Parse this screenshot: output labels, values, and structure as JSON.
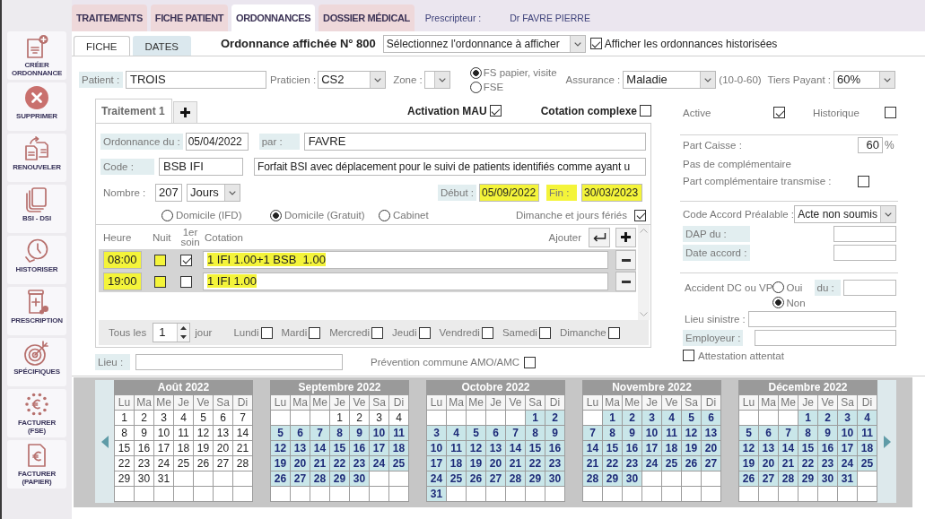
{
  "top_tabs": [
    {
      "label": "TRAITEMENTS",
      "selected": false
    },
    {
      "label": "FICHE PATIENT",
      "selected": false
    },
    {
      "label": "ORDONNANCES",
      "selected": true
    },
    {
      "label": "DOSSIER MÉDICAL",
      "selected": false
    }
  ],
  "prescriber": {
    "label": "Prescripteur :",
    "value": "Dr FAVRE PIERRE"
  },
  "sidebar": {
    "items": [
      {
        "label": "CRÉER ORDONNANCE",
        "kind": "create"
      },
      {
        "label": "SUPPRIMER",
        "kind": "delete"
      },
      {
        "label": "RENOUVELER",
        "kind": "renew"
      },
      {
        "label": "BSI - DSI",
        "kind": "pages"
      },
      {
        "label": "HISTORISER",
        "kind": "history"
      },
      {
        "label": "PRESCRIPTION",
        "kind": "prescription"
      },
      {
        "label": "SPÉCIFIQUES",
        "kind": "target"
      },
      {
        "label": "FACTURER (FSE)",
        "kind": "bill_fse"
      },
      {
        "label": "FACTURER (PAPIER)",
        "kind": "bill_paper"
      }
    ]
  },
  "sub_tabs": [
    {
      "label": "FICHE",
      "selected": true
    },
    {
      "label": "DATES",
      "selected": false
    }
  ],
  "ordonnance": {
    "title": "Ordonnance affichée N° 800",
    "select_value": "Sélectionnez l'ordonnance à afficher",
    "show_historised": {
      "label": "Afficher les ordonnances historisées",
      "checked": true
    }
  },
  "patient_row": {
    "patient": {
      "label": "Patient :",
      "value": "TROIS"
    },
    "praticien": {
      "label": "Praticien :",
      "value": "CS2"
    },
    "zone": {
      "label": "Zone :"
    },
    "billing_mode": [
      {
        "label": "FS papier, visite",
        "selected": true
      },
      {
        "label": "FSE",
        "selected": false
      }
    ],
    "assurance": {
      "label": "Assurance :",
      "value": "Maladie",
      "rates": "(10-0-60)"
    },
    "tiers_payant": {
      "label": "Tiers Payant :",
      "value": "60%"
    }
  },
  "treatment": {
    "tabs": [
      {
        "label": "Traitement 1",
        "selected": true
      }
    ],
    "mau": {
      "label": "Activation MAU",
      "checked": true
    },
    "cotation_complexe": {
      "label": "Cotation complexe",
      "checked": false
    },
    "ordonnance_date": {
      "label": "Ordonnance du :",
      "value": "05/04/2022"
    },
    "par": {
      "label": "par :",
      "value": "FAVRE"
    },
    "code": {
      "label": "Code :",
      "value": "BSB IFI",
      "description": "Forfait BSI avec déplacement pour le suivi de patients identifiés comme ayant u"
    },
    "nombre": {
      "label": "Nombre :",
      "value": "207",
      "unit": "Jours"
    },
    "debut": {
      "label": "Début :",
      "value": "05/09/2022",
      "highlighted": true
    },
    "fin": {
      "label": "Fin :",
      "value": "30/03/2023",
      "highlighted": true
    },
    "place": [
      {
        "label": "Domicile (IFD)",
        "selected": false
      },
      {
        "label": "Domicile (Gratuit)",
        "selected": true
      },
      {
        "label": "Cabinet",
        "selected": false
      }
    ],
    "sundays": {
      "label": "Dimanche et jours fériés",
      "checked": true
    },
    "schedule": {
      "columns": [
        "Heure",
        "Nuit",
        "1er soin",
        "Cotation"
      ],
      "add_label": "Ajouter",
      "rows": [
        {
          "time": "08:00",
          "night": false,
          "first_care": true,
          "cotation": "1 IFI 1.00+1 BSB  1.00",
          "highlighted": true
        },
        {
          "time": "19:00",
          "night": false,
          "first_care": false,
          "cotation": "1 IFI 1.00",
          "highlighted": true
        }
      ]
    },
    "recurrence": {
      "label": "Tous les",
      "value": "1",
      "unit": "jour",
      "days": [
        {
          "label": "Lundi",
          "checked": false
        },
        {
          "label": "Mardi",
          "checked": false
        },
        {
          "label": "Mercredi",
          "checked": false
        },
        {
          "label": "Jeudi",
          "checked": false
        },
        {
          "label": "Vendredi",
          "checked": false
        },
        {
          "label": "Samedi",
          "checked": false
        },
        {
          "label": "Dimanche",
          "checked": false
        }
      ]
    }
  },
  "lieu": {
    "label": "Lieu :"
  },
  "prevention": {
    "label": "Prévention commune AMO/AMC",
    "checked": false
  },
  "status": {
    "active": {
      "label": "Active",
      "checked": true
    },
    "historique": {
      "label": "Historique",
      "checked": false
    }
  },
  "coverage": {
    "part_caisse": {
      "label": "Part Caisse :",
      "value": "60",
      "unit": "%"
    },
    "complementaire": "Pas de complémentaire",
    "part_complementaire": {
      "label": "Part complémentaire transmise :",
      "checked": false
    }
  },
  "accord": {
    "code": {
      "label": "Code Accord Préalable :",
      "value": "Acte non soumis"
    },
    "dap": {
      "label": "DAP du :"
    },
    "date_accord": {
      "label": "Date accord :"
    }
  },
  "accident": {
    "label": "Accident DC ou VP",
    "options": [
      {
        "label": "Oui",
        "selected": false
      },
      {
        "label": "Non",
        "selected": true
      }
    ],
    "date": {
      "label": "du :"
    },
    "lieu_sinistre": {
      "label": "Lieu sinistre :"
    },
    "employeur": {
      "label": "Employeur :"
    },
    "attestation": {
      "label": "Attestation attentat",
      "checked": false
    }
  },
  "calendar": {
    "months": [
      {
        "title": "Août 2022",
        "weekdays": [
          "Lu",
          "Ma",
          "Me",
          "Je",
          "Ve",
          "Sa",
          "Di"
        ],
        "weeks": [
          [
            {
              "day": "1",
              "highlighted": false
            },
            {
              "day": "2",
              "highlighted": false
            },
            {
              "day": "3",
              "highlighted": false
            },
            {
              "day": "4",
              "highlighted": false
            },
            {
              "day": "5",
              "highlighted": false
            },
            {
              "day": "6",
              "highlighted": false
            },
            {
              "day": "7",
              "highlighted": false
            }
          ],
          [
            {
              "day": "8",
              "highlighted": false
            },
            {
              "day": "9",
              "highlighted": false
            },
            {
              "day": "10",
              "highlighted": false
            },
            {
              "day": "11",
              "highlighted": false
            },
            {
              "day": "12",
              "highlighted": false
            },
            {
              "day": "13",
              "highlighted": false
            },
            {
              "day": "14",
              "highlighted": false
            }
          ],
          [
            {
              "day": "15",
              "highlighted": false
            },
            {
              "day": "16",
              "highlighted": false
            },
            {
              "day": "17",
              "highlighted": false
            },
            {
              "day": "18",
              "highlighted": false
            },
            {
              "day": "19",
              "highlighted": false
            },
            {
              "day": "20",
              "highlighted": false
            },
            {
              "day": "21",
              "highlighted": false
            }
          ],
          [
            {
              "day": "22",
              "highlighted": false
            },
            {
              "day": "23",
              "highlighted": false
            },
            {
              "day": "24",
              "highlighted": false
            },
            {
              "day": "25",
              "highlighted": false
            },
            {
              "day": "26",
              "highlighted": false
            },
            {
              "day": "27",
              "highlighted": false
            },
            {
              "day": "28",
              "highlighted": false
            }
          ],
          [
            {
              "day": "29",
              "highlighted": false
            },
            {
              "day": "30",
              "highlighted": false
            },
            {
              "day": "31",
              "highlighted": false
            }
          ]
        ]
      },
      {
        "title": "Septembre 2022",
        "weekdays": [
          "Lu",
          "Ma",
          "Me",
          "Je",
          "Ve",
          "Sa",
          "Di"
        ],
        "weeks": [
          [
            {
              "day": "1",
              "highlighted": false
            },
            {
              "day": "2",
              "highlighted": false
            },
            {
              "day": "3",
              "highlighted": false
            },
            {
              "day": "4",
              "highlighted": false
            }
          ],
          [
            {
              "day": "5",
              "highlighted": true
            },
            {
              "day": "6",
              "highlighted": true
            },
            {
              "day": "7",
              "highlighted": true
            },
            {
              "day": "8",
              "highlighted": true
            },
            {
              "day": "9",
              "highlighted": true
            },
            {
              "day": "10",
              "highlighted": true
            },
            {
              "day": "11",
              "highlighted": true
            }
          ],
          [
            {
              "day": "12",
              "highlighted": true
            },
            {
              "day": "13",
              "highlighted": true
            },
            {
              "day": "14",
              "highlighted": true
            },
            {
              "day": "15",
              "highlighted": true
            },
            {
              "day": "16",
              "highlighted": true
            },
            {
              "day": "17",
              "highlighted": true
            },
            {
              "day": "18",
              "highlighted": true
            }
          ],
          [
            {
              "day": "19",
              "highlighted": true
            },
            {
              "day": "20",
              "highlighted": true
            },
            {
              "day": "21",
              "highlighted": true
            },
            {
              "day": "22",
              "highlighted": true
            },
            {
              "day": "23",
              "highlighted": true
            },
            {
              "day": "24",
              "highlighted": true
            },
            {
              "day": "25",
              "highlighted": true
            }
          ],
          [
            {
              "day": "26",
              "highlighted": true
            },
            {
              "day": "27",
              "highlighted": true
            },
            {
              "day": "28",
              "highlighted": true
            },
            {
              "day": "29",
              "highlighted": true
            },
            {
              "day": "30",
              "highlighted": true
            }
          ]
        ]
      },
      {
        "title": "Octobre 2022",
        "weekdays": [
          "Lu",
          "Ma",
          "Me",
          "Je",
          "Ve",
          "Sa",
          "Di"
        ],
        "weeks": [
          [
            {
              "day": "1",
              "highlighted": true
            },
            {
              "day": "2",
              "highlighted": true
            }
          ],
          [
            {
              "day": "3",
              "highlighted": true
            },
            {
              "day": "4",
              "highlighted": true
            },
            {
              "day": "5",
              "highlighted": true
            },
            {
              "day": "6",
              "highlighted": true
            },
            {
              "day": "7",
              "highlighted": true
            },
            {
              "day": "8",
              "highlighted": true
            },
            {
              "day": "9",
              "highlighted": true
            }
          ],
          [
            {
              "day": "10",
              "highlighted": true
            },
            {
              "day": "11",
              "highlighted": true
            },
            {
              "day": "12",
              "highlighted": true
            },
            {
              "day": "13",
              "highlighted": true
            },
            {
              "day": "14",
              "highlighted": true
            },
            {
              "day": "15",
              "highlighted": true
            },
            {
              "day": "16",
              "highlighted": true
            }
          ],
          [
            {
              "day": "17",
              "highlighted": true
            },
            {
              "day": "18",
              "highlighted": true
            },
            {
              "day": "19",
              "highlighted": true
            },
            {
              "day": "20",
              "highlighted": true
            },
            {
              "day": "21",
              "highlighted": true
            },
            {
              "day": "22",
              "highlighted": true
            },
            {
              "day": "23",
              "highlighted": true
            }
          ],
          [
            {
              "day": "24",
              "highlighted": true
            },
            {
              "day": "25",
              "highlighted": true
            },
            {
              "day": "26",
              "highlighted": true
            },
            {
              "day": "27",
              "highlighted": true
            },
            {
              "day": "28",
              "highlighted": true
            },
            {
              "day": "29",
              "highlighted": true
            },
            {
              "day": "30",
              "highlighted": true
            }
          ],
          [
            {
              "day": "31",
              "highlighted": true
            }
          ]
        ]
      },
      {
        "title": "Novembre 2022",
        "weekdays": [
          "Lu",
          "Ma",
          "Me",
          "Je",
          "Ve",
          "Sa",
          "Di"
        ],
        "weeks": [
          [
            {
              "day": "1",
              "highlighted": true
            },
            {
              "day": "2",
              "highlighted": true
            },
            {
              "day": "3",
              "highlighted": true
            },
            {
              "day": "4",
              "highlighted": true
            },
            {
              "day": "5",
              "highlighted": true
            },
            {
              "day": "6",
              "highlighted": true
            }
          ],
          [
            {
              "day": "7",
              "highlighted": true
            },
            {
              "day": "8",
              "highlighted": true
            },
            {
              "day": "9",
              "highlighted": true
            },
            {
              "day": "10",
              "highlighted": true
            },
            {
              "day": "11",
              "highlighted": true
            },
            {
              "day": "12",
              "highlighted": true
            },
            {
              "day": "13",
              "highlighted": true
            }
          ],
          [
            {
              "day": "14",
              "highlighted": true
            },
            {
              "day": "15",
              "highlighted": true
            },
            {
              "day": "16",
              "highlighted": true
            },
            {
              "day": "17",
              "highlighted": true
            },
            {
              "day": "18",
              "highlighted": true
            },
            {
              "day": "19",
              "highlighted": true
            },
            {
              "day": "20",
              "highlighted": true
            }
          ],
          [
            {
              "day": "21",
              "highlighted": true
            },
            {
              "day": "22",
              "highlighted": true
            },
            {
              "day": "23",
              "highlighted": true
            },
            {
              "day": "24",
              "highlighted": true
            },
            {
              "day": "25",
              "highlighted": true
            },
            {
              "day": "26",
              "highlighted": true
            },
            {
              "day": "27",
              "highlighted": true
            }
          ],
          [
            {
              "day": "28",
              "highlighted": true
            },
            {
              "day": "29",
              "highlighted": true
            },
            {
              "day": "30",
              "highlighted": true
            }
          ]
        ]
      },
      {
        "title": "Décembre 2022",
        "weekdays": [
          "Lu",
          "Ma",
          "Me",
          "Je",
          "Ve",
          "Sa",
          "Di"
        ],
        "weeks": [
          [
            {
              "day": "1",
              "highlighted": true
            },
            {
              "day": "2",
              "highlighted": true
            },
            {
              "day": "3",
              "highlighted": true
            },
            {
              "day": "4",
              "highlighted": true
            }
          ],
          [
            {
              "day": "5",
              "highlighted": true
            },
            {
              "day": "6",
              "highlighted": true
            },
            {
              "day": "7",
              "highlighted": true
            },
            {
              "day": "8",
              "highlighted": true
            },
            {
              "day": "9",
              "highlighted": true
            },
            {
              "day": "10",
              "highlighted": true
            },
            {
              "day": "11",
              "highlighted": true
            }
          ],
          [
            {
              "day": "12",
              "highlighted": true
            },
            {
              "day": "13",
              "highlighted": true
            },
            {
              "day": "14",
              "highlighted": true
            },
            {
              "day": "15",
              "highlighted": true
            },
            {
              "day": "16",
              "highlighted": true
            },
            {
              "day": "17",
              "highlighted": true
            },
            {
              "day": "18",
              "highlighted": true
            }
          ],
          [
            {
              "day": "19",
              "highlighted": true
            },
            {
              "day": "20",
              "highlighted": true
            },
            {
              "day": "21",
              "highlighted": true
            },
            {
              "day": "22",
              "highlighted": true
            },
            {
              "day": "23",
              "highlighted": true
            },
            {
              "day": "24",
              "highlighted": true
            },
            {
              "day": "25",
              "highlighted": true
            }
          ],
          [
            {
              "day": "26",
              "highlighted": true
            },
            {
              "day": "27",
              "highlighted": true
            },
            {
              "day": "28",
              "highlighted": true
            },
            {
              "day": "29",
              "highlighted": true
            },
            {
              "day": "30",
              "highlighted": true
            },
            {
              "day": "31",
              "highlighted": true
            }
          ]
        ]
      }
    ]
  }
}
